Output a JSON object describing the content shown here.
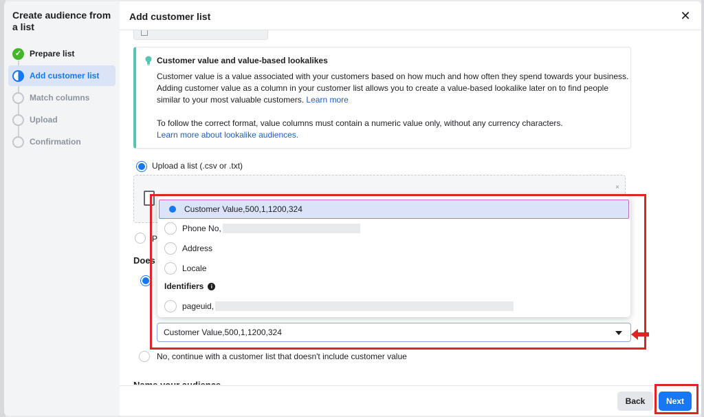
{
  "sidebar": {
    "title": "Create audience from a list",
    "steps": [
      {
        "label": "Prepare list",
        "state": "done"
      },
      {
        "label": "Add customer list",
        "state": "active"
      },
      {
        "label": "Match columns",
        "state": "future"
      },
      {
        "label": "Upload",
        "state": "future"
      },
      {
        "label": "Confirmation",
        "state": "future"
      }
    ]
  },
  "header": {
    "title": "Add customer list",
    "close_icon": "close-icon"
  },
  "tip": {
    "title": "Customer value and value-based lookalikes",
    "body": "Customer value is a value associated with your customers based on how much and how often they spend towards your business. Adding customer value as a column in your customer list allows you to create a value-based lookalike later on to find people similar to your most valuable customers.",
    "body_link": "Learn more",
    "body2": "To follow the correct format, value columns must contain a numeric value only, without any currency characters.",
    "body2_link": "Learn more about lookalike audiences.",
    "icon": "lightbulb-icon",
    "accent": "#57c6b0"
  },
  "upload": {
    "label": "Upload a list (.csv or .txt)",
    "partial_option": "P",
    "close_mark": "×"
  },
  "question": {
    "label_visible": "Does"
  },
  "menu": {
    "items": [
      {
        "label": "Customer Value,500,1,1200,324",
        "selected": true
      },
      {
        "label": "Phone No,",
        "selected": false
      },
      {
        "label": "Address",
        "selected": false
      },
      {
        "label": "Locale",
        "selected": false
      }
    ],
    "section_label": "Identifiers",
    "section_items": [
      {
        "label": "pageuid,",
        "selected": false
      }
    ]
  },
  "select": {
    "value": "Customer Value,500,1,1200,324"
  },
  "no_option": {
    "label": "No, continue with a customer list that doesn't include customer value"
  },
  "name_section": {
    "label": "Name your audience"
  },
  "footer": {
    "back_label": "Back",
    "next_label": "Next"
  },
  "colors": {
    "primary": "#1877f2",
    "annotation_red": "#e02424",
    "success_green": "#42b72a"
  }
}
